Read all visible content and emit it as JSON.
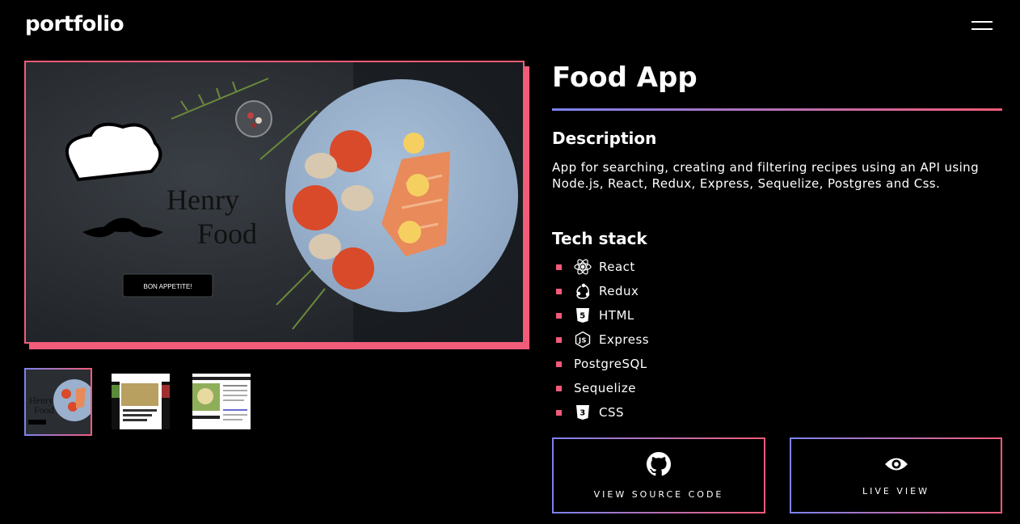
{
  "header": {
    "logo": "portfolio",
    "menu_icon": "hamburger-menu-icon"
  },
  "preview": {
    "logo_line1": "Henry",
    "logo_line2": "Food",
    "cta": "BON APPETITE!"
  },
  "thumbnails": [
    {
      "name": "thumbnail-1",
      "selected": true
    },
    {
      "name": "thumbnail-2",
      "selected": false,
      "caption": "HOMEMADE SALAD AND BASIL-FRIED TOFU"
    },
    {
      "name": "thumbnail-3",
      "selected": false,
      "caption": "ER, BROWN RICE, AND VEGETABLE",
      "caption2": "VE HEALTHY"
    }
  ],
  "project": {
    "title": "Food App",
    "description_heading": "Description",
    "description": "App for searching, creating and filtering recipes using an API using Node.js, React, Redux, Express, Sequelize, Postgres and Css.",
    "tech_heading": "Tech stack",
    "tech": [
      {
        "label": "React",
        "icon": "react-icon"
      },
      {
        "label": "Redux",
        "icon": "redux-icon"
      },
      {
        "label": "HTML",
        "icon": "html5-icon"
      },
      {
        "label": "Express",
        "icon": "nodejs-icon"
      },
      {
        "label": "PostgreSQL",
        "icon": ""
      },
      {
        "label": "Sequelize",
        "icon": ""
      },
      {
        "label": "CSS",
        "icon": "css3-icon"
      }
    ]
  },
  "actions": {
    "source_label": "VIEW SOURCE CODE",
    "source_icon": "github-icon",
    "live_label": "LIVE VIEW",
    "live_icon": "eye-icon"
  },
  "colors": {
    "accent_pink": "#f25c78",
    "accent_blue": "#7b83f0",
    "background": "#000000"
  }
}
